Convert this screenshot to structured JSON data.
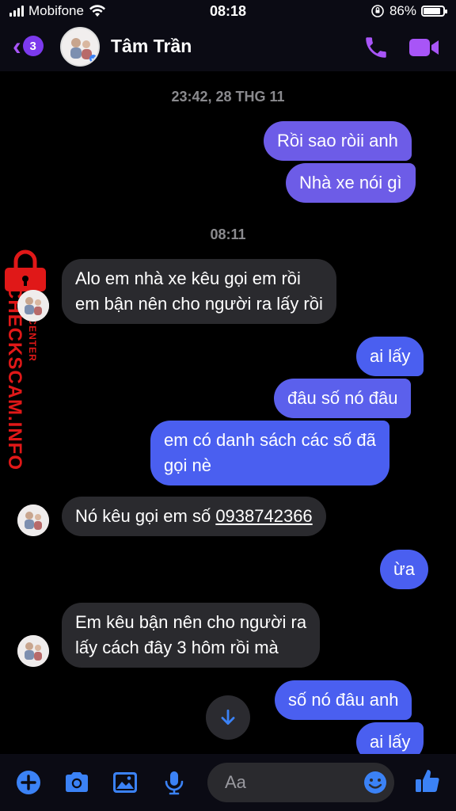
{
  "status_bar": {
    "carrier": "Mobifone",
    "time": "08:18",
    "battery": "86%"
  },
  "header": {
    "back_count": "3",
    "contact_name": "Tâm Trần"
  },
  "conversation": {
    "timestamp_1": "23:42, 28 THG 11",
    "timestamp_2": "08:11",
    "messages": [
      {
        "direction": "out",
        "text": "Rồi sao ròii anh"
      },
      {
        "direction": "out",
        "text": "Nhà xe nói gì"
      },
      {
        "direction": "in",
        "line1": "Alo em nhà xe kêu gọi em rồi",
        "line2": "em bận nên cho người ra lấy rồi"
      },
      {
        "direction": "out",
        "text": "ai lấy"
      },
      {
        "direction": "out",
        "text": "đâu số nó đâu"
      },
      {
        "direction": "out",
        "line1": "em có danh sách các số đã",
        "line2": "gọi nè"
      },
      {
        "direction": "in",
        "prefix": "Nó kêu gọi em số ",
        "phone": "0938742366"
      },
      {
        "direction": "out",
        "text": "ừa"
      },
      {
        "direction": "in",
        "line1": "Em kêu bận nên cho người ra",
        "line2": "lấy cách đây 3 hôm rồi mà"
      },
      {
        "direction": "out",
        "text": "số nó đâu anh"
      },
      {
        "direction": "out",
        "text": "ai lấy"
      }
    ]
  },
  "watermark": {
    "main": "CHECKSCAM.INFO",
    "sub": "DATA CENTER"
  },
  "composer": {
    "placeholder": "Aa"
  },
  "colors": {
    "accent": "#a855f7",
    "outgoing_bubble": "#6d5ce7",
    "incoming_bubble": "#2a2a2e",
    "watermark": "#e01818"
  }
}
